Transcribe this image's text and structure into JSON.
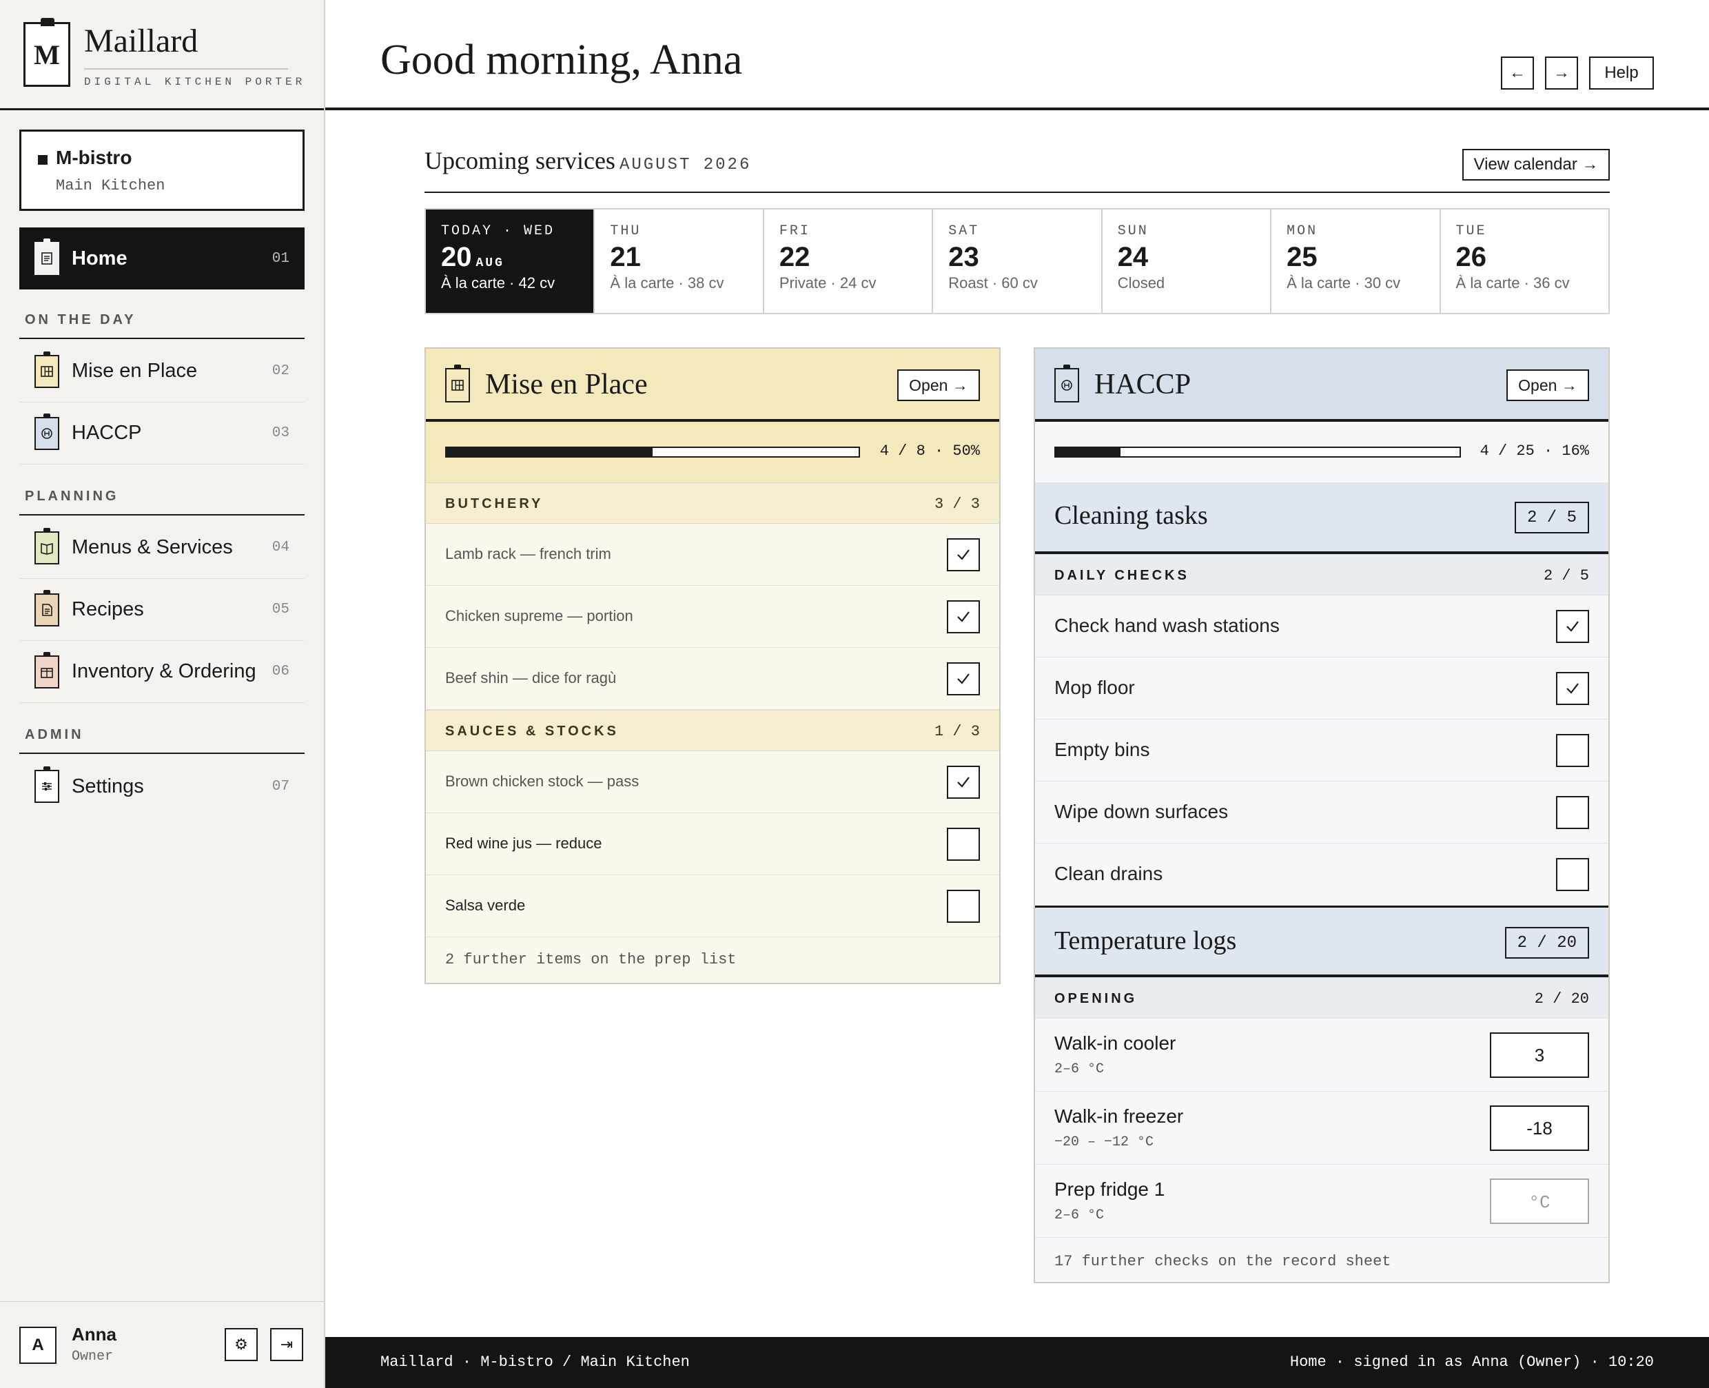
{
  "brand": {
    "initial": "M",
    "name": "Maillard",
    "tagline": "DIGITAL KITCHEN PORTER"
  },
  "kitchen": {
    "name": "M-bistro",
    "sub": "Main Kitchen"
  },
  "nav": {
    "home": {
      "label": "Home",
      "num": "01",
      "icon": "home-doc-icon"
    },
    "sections": {
      "day": "ON THE DAY",
      "planning": "PLANNING",
      "admin": "ADMIN"
    },
    "items": [
      {
        "label": "Mise en Place",
        "num": "02",
        "icon": "mise-grid-icon",
        "color": "#f3e9bc"
      },
      {
        "label": "HACCP",
        "num": "03",
        "icon": "haccp-seal-icon",
        "color": "#d7e0ea"
      },
      {
        "label": "Menus & Services",
        "num": "04",
        "icon": "menu-book-icon",
        "color": "#e3e8c2"
      },
      {
        "label": "Recipes",
        "num": "05",
        "icon": "recipe-doc-icon",
        "color": "#e9d6b7"
      },
      {
        "label": "Inventory & Ordering",
        "num": "06",
        "icon": "inventory-box-icon",
        "color": "#efd6c6"
      },
      {
        "label": "Settings",
        "num": "07",
        "icon": "settings-sliders-icon",
        "color": "#ffffff"
      }
    ]
  },
  "user": {
    "initial": "A",
    "name": "Anna",
    "role": "Owner",
    "settings_glyph": "⚙",
    "logout_glyph": "⇥"
  },
  "header": {
    "greeting": "Good morning, Anna",
    "back_glyph": "←",
    "forward_glyph": "→",
    "help_label": "Help"
  },
  "upcoming": {
    "title": "Upcoming services",
    "month": "AUGUST 2026",
    "view_calendar": "View calendar →",
    "days": [
      {
        "name": "TODAY · WED",
        "num": "20",
        "month": "AUG",
        "info": "À la carte · 42 cv"
      },
      {
        "name": "THU",
        "num": "21",
        "month": "",
        "info": "À la carte · 38 cv"
      },
      {
        "name": "FRI",
        "num": "22",
        "month": "",
        "info": "Private · 24 cv"
      },
      {
        "name": "SAT",
        "num": "23",
        "month": "",
        "info": "Roast · 60 cv"
      },
      {
        "name": "SUN",
        "num": "24",
        "month": "",
        "info": "Closed"
      },
      {
        "name": "MON",
        "num": "25",
        "month": "",
        "info": "À la carte · 30 cv"
      },
      {
        "name": "TUE",
        "num": "26",
        "month": "",
        "info": "À la carte · 36 cv"
      }
    ]
  },
  "mise": {
    "title": "Mise en Place",
    "open": "Open →",
    "progress": {
      "text": "4 / 8 · 50%",
      "fraction": 0.5
    },
    "groups": [
      {
        "label": "BUTCHERY",
        "count": "3 / 3"
      },
      {
        "label": "SAUCES & STOCKS",
        "count": "1 / 3"
      }
    ],
    "tasks": [
      {
        "label": "Lamb rack — french trim",
        "done": true
      },
      {
        "label": "Chicken supreme — portion",
        "done": true
      },
      {
        "label": "Beef shin — dice for ragù",
        "done": true
      },
      {
        "label": "Brown chicken stock — pass",
        "done": true
      },
      {
        "label": "Red wine jus — reduce",
        "done": false
      },
      {
        "label": "Salsa verde",
        "done": false
      }
    ],
    "footer": "2 further items on the prep list"
  },
  "haccp": {
    "title": "HACCP",
    "open": "Open →",
    "progress": {
      "text": "4 / 25 · 16%",
      "fraction": 0.16
    },
    "cleaning": {
      "title": "Cleaning tasks",
      "count": "2 / 5",
      "group": {
        "label": "DAILY CHECKS",
        "count": "2 / 5"
      },
      "tasks": [
        {
          "label": "Check hand wash stations",
          "done": true
        },
        {
          "label": "Mop floor",
          "done": true
        },
        {
          "label": "Empty bins",
          "done": false
        },
        {
          "label": "Wipe down surfaces",
          "done": false
        },
        {
          "label": "Clean drains",
          "done": false
        }
      ]
    },
    "temperature": {
      "title": "Temperature logs",
      "count": "2 / 20",
      "group": {
        "label": "OPENING",
        "count": "2 / 20"
      },
      "logs": [
        {
          "name": "Walk-in cooler",
          "range": "2–6 °C",
          "value": "3",
          "placeholder": ""
        },
        {
          "name": "Walk-in freezer",
          "range": "−20 – −12 °C",
          "value": "-18",
          "placeholder": ""
        },
        {
          "name": "Prep fridge 1",
          "range": "2–6 °C",
          "value": "",
          "placeholder": "°C"
        }
      ]
    },
    "footer": "17 further checks on the record sheet"
  },
  "status": {
    "left": "Maillard · M-bistro / Main Kitchen",
    "right": "Home · signed in as Anna (Owner) · 10:20"
  }
}
